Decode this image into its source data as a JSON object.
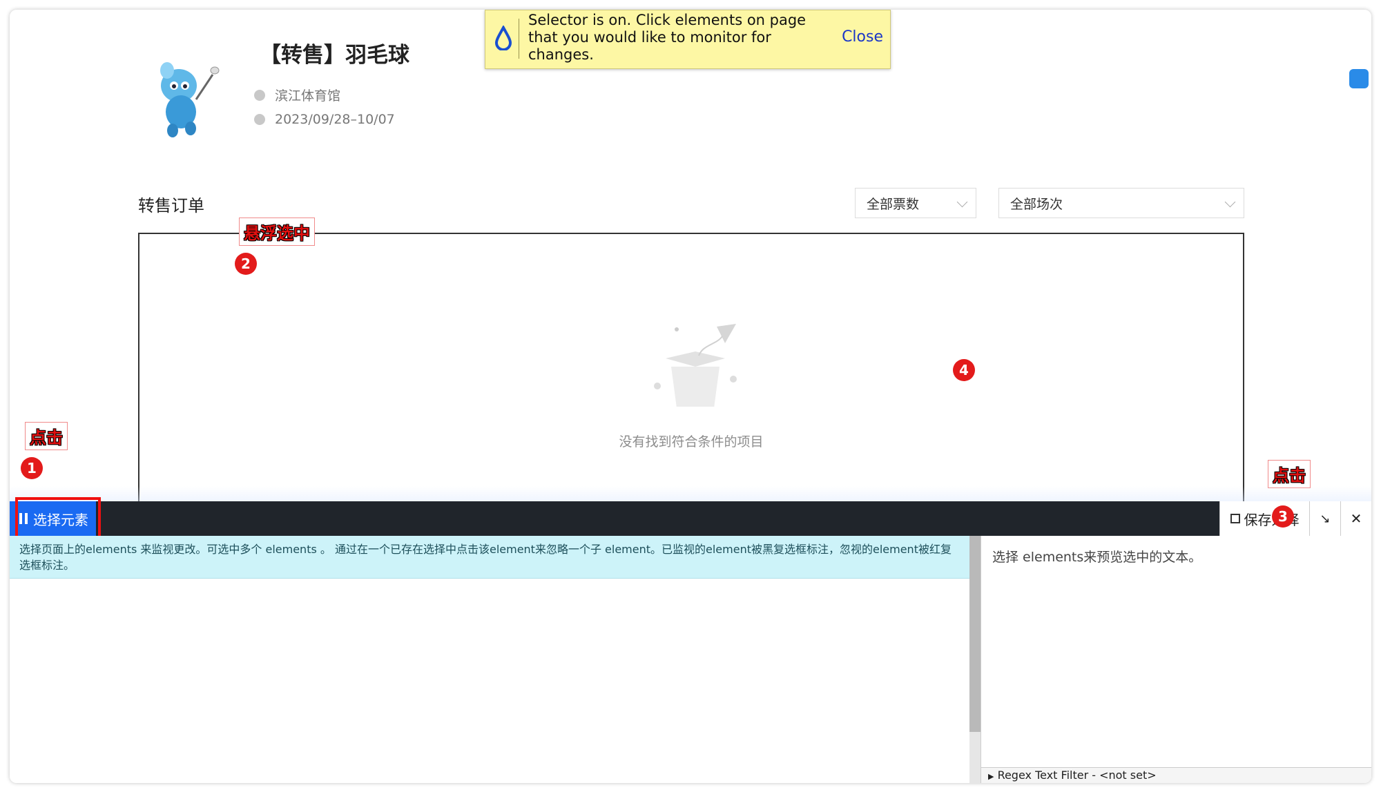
{
  "event": {
    "title": "【转售】羽毛球",
    "venue": "滨江体育馆",
    "dates": "2023/09/28–10/07"
  },
  "notice": {
    "message": "Selector is on. Click elements on page that you would like to monitor for changes.",
    "close_label": "Close"
  },
  "orders": {
    "title": "转售订单",
    "filter_tickets": "全部票数",
    "filter_sessions": "全部场次",
    "empty_text": "没有找到符合条件的项目"
  },
  "annotations": {
    "click_1": "点击",
    "hover_select": "悬浮选中",
    "click_3": "点击",
    "badge_1": "1",
    "badge_2": "2",
    "badge_3": "3",
    "badge_4": "4"
  },
  "panel": {
    "select_button": "选择元素",
    "save_button": "保存选择",
    "help_text": "选择页面上的elements 来监视更改。可选中多个 elements 。 通过在一个已存在选择中点击该element来忽略一个子 element。已监视的element被黑复选框标注，忽视的element被红复选框标注。",
    "preview_text": "选择 elements来预览选中的文本。",
    "regex_filter": "Regex Text Filter - <not set>"
  },
  "colors": {
    "notice_bg": "#fdf7a4",
    "toolbar_bg": "#20252b",
    "select_button_bg": "#1a6af2",
    "help_bg": "#cdf3f9",
    "annotation_red": "#e31b1b"
  }
}
